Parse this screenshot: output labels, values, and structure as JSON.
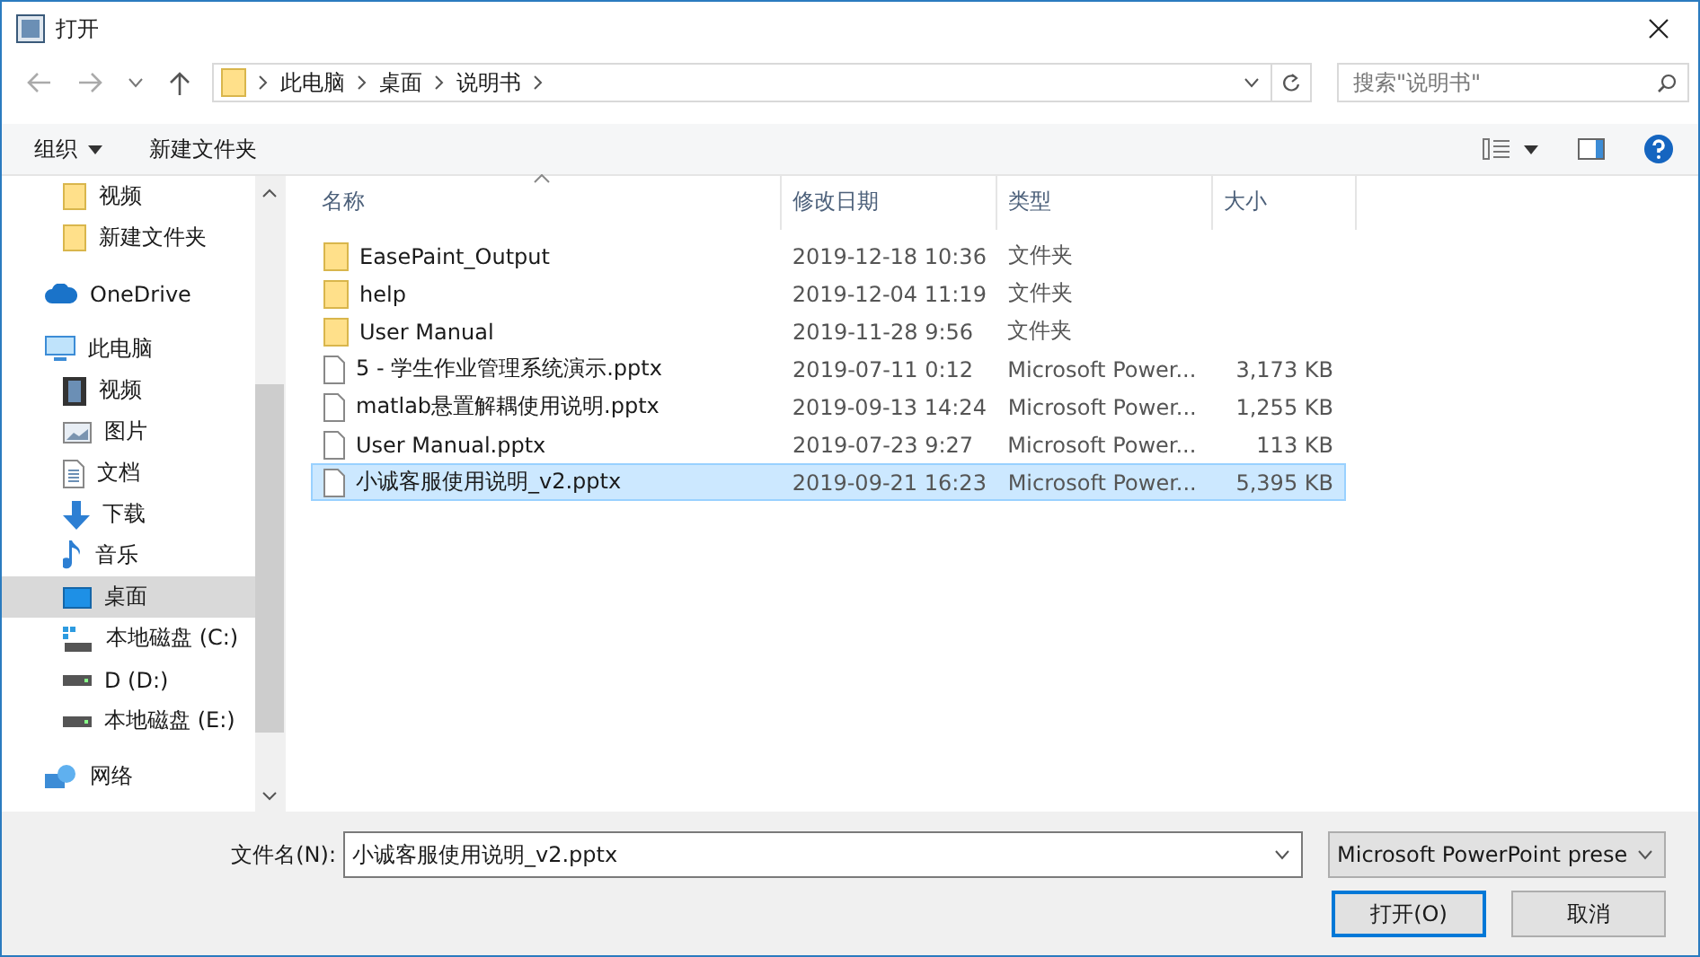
{
  "window": {
    "title": "打开"
  },
  "address_bar": {
    "path": [
      "此电脑",
      "桌面",
      "说明书"
    ]
  },
  "search": {
    "placeholder": "搜索\"说明书\""
  },
  "toolbar": {
    "buttons": [
      "组织",
      "新建文件夹"
    ]
  },
  "sidebar": {
    "items": [
      {
        "label": "视频",
        "kind": "folder",
        "selected": false
      },
      {
        "label": "新建文件夹",
        "kind": "folder",
        "selected": false
      },
      {
        "label": "OneDrive",
        "kind": "cloud",
        "selected": false
      },
      {
        "label": "此电脑",
        "kind": "pc",
        "selected": false,
        "children": [
          {
            "label": "视频",
            "kind": "video",
            "selected": false
          },
          {
            "label": "图片",
            "kind": "pictures",
            "selected": false
          },
          {
            "label": "文档",
            "kind": "documents",
            "selected": false
          },
          {
            "label": "下载",
            "kind": "downloads",
            "selected": false
          },
          {
            "label": "音乐",
            "kind": "music",
            "selected": false
          },
          {
            "label": "桌面",
            "kind": "desktop",
            "selected": true
          },
          {
            "label": "本地磁盘 (C:)",
            "kind": "system-drive",
            "selected": false
          },
          {
            "label": "D (D:)",
            "kind": "drive",
            "selected": false
          },
          {
            "label": "本地磁盘 (E:)",
            "kind": "drive",
            "selected": false
          }
        ]
      },
      {
        "label": "网络",
        "kind": "network",
        "selected": false
      }
    ]
  },
  "table": {
    "columns": [
      "名称",
      "修改日期",
      "类型",
      "大小"
    ],
    "rows": [
      {
        "kind": "folder",
        "name": "EasePaint_Output",
        "date": "2019-12-18 10:36",
        "type": "文件夹",
        "size": "",
        "selected": false
      },
      {
        "kind": "folder",
        "name": "help",
        "date": "2019-12-04 11:19",
        "type": "文件夹",
        "size": "",
        "selected": false
      },
      {
        "kind": "folder",
        "name": "User Manual",
        "date": "2019-11-28 9:56",
        "type": "文件夹",
        "size": "",
        "selected": false
      },
      {
        "kind": "file",
        "name": "5 - 学生作业管理系统演示.pptx",
        "date": "2019-07-11 0:12",
        "type": "Microsoft Power...",
        "size": "3,173 KB",
        "selected": false
      },
      {
        "kind": "file",
        "name": "matlab悬置解耦使用说明.pptx",
        "date": "2019-09-13 14:24",
        "type": "Microsoft Power...",
        "size": "1,255 KB",
        "selected": false
      },
      {
        "kind": "file",
        "name": "User Manual.pptx",
        "date": "2019-07-23 9:27",
        "type": "Microsoft Power...",
        "size": "113 KB",
        "selected": false
      },
      {
        "kind": "file",
        "name": "小诚客服使用说明_v2.pptx",
        "date": "2019-09-21 16:23",
        "type": "Microsoft Power...",
        "size": "5,395 KB",
        "selected": true
      }
    ]
  },
  "footer": {
    "filename_label": "文件名(N):",
    "filename": "小诚客服使用说明_v2.pptx",
    "filetype": "Microsoft PowerPoint prese",
    "buttons": [
      "打开(O)",
      "取消"
    ]
  }
}
